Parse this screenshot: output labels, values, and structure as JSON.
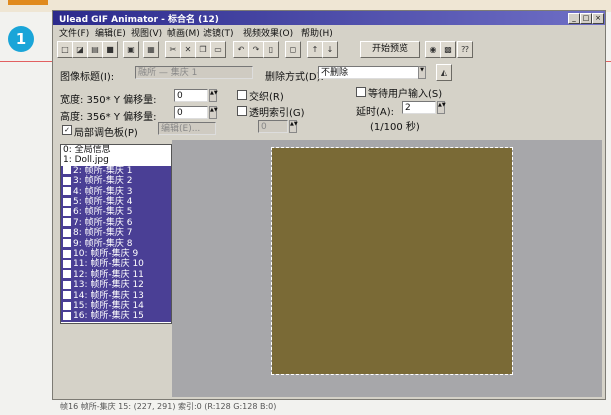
{
  "step_number": "1",
  "window": {
    "title": "Ulead GIF Animator - 标合名 (12)",
    "controls": [
      "_",
      "□",
      "×"
    ]
  },
  "menu": [
    "文件(F)",
    "编辑(E)",
    "视图(V)",
    "帧画(M)",
    "滤镜(T)",
    "视频效果(O)",
    "帮助(H)"
  ],
  "toolbar": {
    "preview_label": "开始预览"
  },
  "frame_props": {
    "title_label": "图像标题(I):",
    "title_value": "融所 — 集庆 1",
    "removal_label": "删除方式(D):",
    "removal_value": "不删除",
    "width_label": "宽度: 350* Y 偏移量:",
    "width_offset": "0",
    "height_label": "高度: 356* Y 偏移量:",
    "height_offset": "0",
    "local_palette_label": "局部调色板(P)",
    "local_palette_button": "编辑(E)...",
    "interlace_label": "交织(R)",
    "transparent_label": "透明索引(G)",
    "transparent_value": "0",
    "wait_input_label": "等待用户输入(S)",
    "delay_label": "延时(A):",
    "delay_value": "2",
    "delay_unit": "(1/100 秒)"
  },
  "frame_list": [
    {
      "label": "0: 全局信息",
      "selected": false
    },
    {
      "label": "1: Doll.jpg",
      "selected": false
    },
    {
      "label": "2: 帧所-集庆 1",
      "selected": true
    },
    {
      "label": "3: 帧所-集庆 2",
      "selected": true
    },
    {
      "label": "4: 帧所-集庆 3",
      "selected": true
    },
    {
      "label": "5: 帧所-集庆 4",
      "selected": true
    },
    {
      "label": "6: 帧所-集庆 5",
      "selected": true
    },
    {
      "label": "7: 帧所-集庆 6",
      "selected": true
    },
    {
      "label": "8: 帧所-集庆 7",
      "selected": true
    },
    {
      "label": "9: 帧所-集庆 8",
      "selected": true
    },
    {
      "label": "10: 帧所-集庆 9",
      "selected": true
    },
    {
      "label": "11: 帧所-集庆 10",
      "selected": true
    },
    {
      "label": "12: 帧所-集庆 11",
      "selected": true
    },
    {
      "label": "13: 帧所-集庆 12",
      "selected": true
    },
    {
      "label": "14: 帧所-集庆 13",
      "selected": true
    },
    {
      "label": "15: 帧所-集庆 14",
      "selected": true
    },
    {
      "label": "16: 帧所-集庆 15",
      "selected": true
    }
  ],
  "status": "帧16 帧所-集庆 15: (227, 291) 索引:0 (R:128 G:128 B:0)",
  "colors": {
    "selection": "#4a3f95",
    "frame_fill": "#7a6a36",
    "canvas_bg": "#a7a7aa",
    "title_bar": "#2b2a8c",
    "accent_circle": "#1aa5d8"
  }
}
